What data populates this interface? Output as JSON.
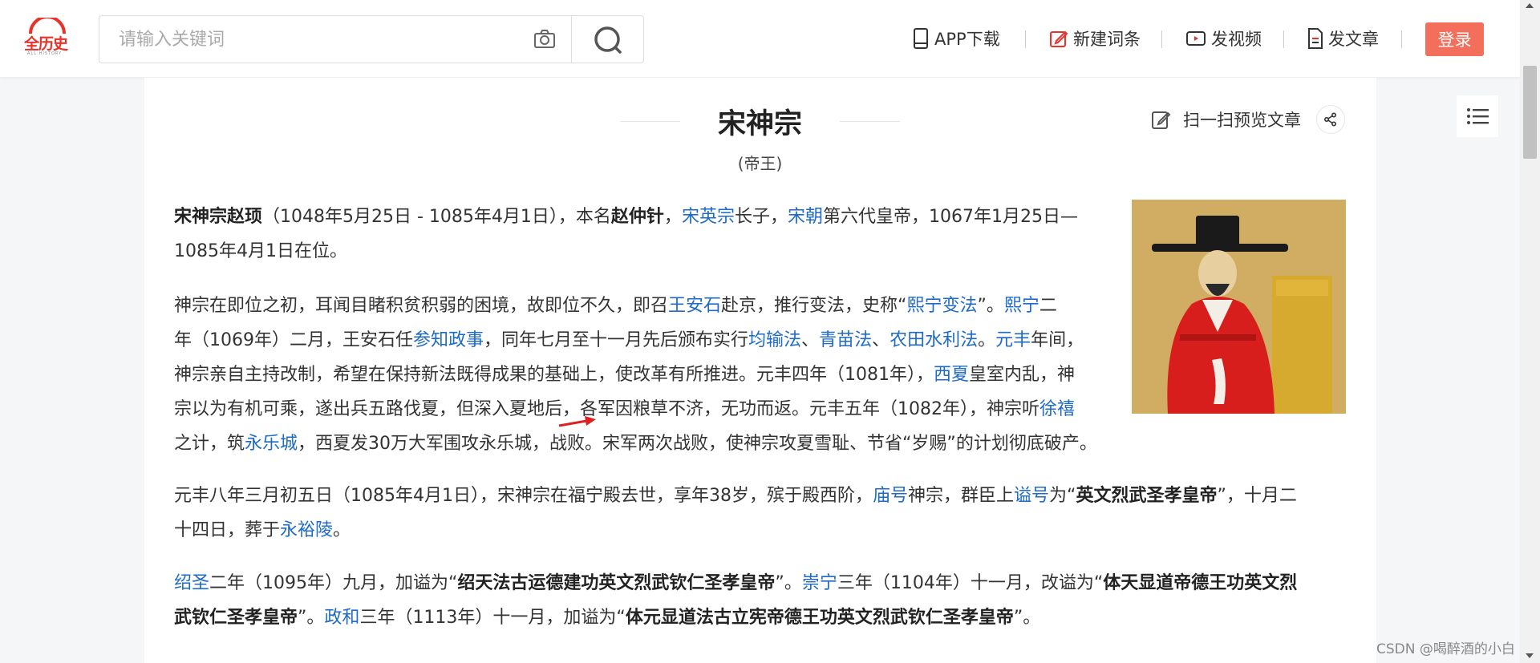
{
  "header": {
    "logo_text": "全历史",
    "logo_sub": "ALL HISTORY",
    "search_placeholder": "请输入关键词",
    "nav": [
      {
        "label": "APP下载",
        "icon": "phone-icon"
      },
      {
        "label": "新建词条",
        "icon": "edit-icon"
      },
      {
        "label": "发视频",
        "icon": "video-icon"
      },
      {
        "label": "发文章",
        "icon": "document-icon"
      }
    ],
    "login_label": "登录"
  },
  "article": {
    "title": "宋神宗",
    "subtitle": "(帝王)",
    "scan_label": "扫一扫预览文章",
    "paragraphs": [
      [
        {
          "t": "宋神宗赵顼",
          "b": true
        },
        {
          "t": "（1048年5月25日 - 1085年4月1日），本名"
        },
        {
          "t": "赵仲针",
          "b": true
        },
        {
          "t": "，"
        },
        {
          "t": "宋英宗",
          "link": true
        },
        {
          "t": "长子，"
        },
        {
          "t": "宋朝",
          "link": true
        },
        {
          "t": "第六代皇帝，1067年1月25日—"
        },
        {
          "br": true
        },
        {
          "t": "1085年4月1日在位。"
        }
      ],
      [
        {
          "t": "神宗在即位之初，耳闻目睹积贫积弱的困境，故即位不久，即召"
        },
        {
          "t": "王安石",
          "link": true
        },
        {
          "t": "赴京，推行变法，史称“"
        },
        {
          "t": "熙宁变法",
          "link": true
        },
        {
          "t": "”。"
        },
        {
          "t": "熙宁",
          "link": true
        },
        {
          "t": "二"
        },
        {
          "br": true
        },
        {
          "t": "年（1069年）二月，王安石任"
        },
        {
          "t": "参知政事",
          "link": true
        },
        {
          "t": "，同年七月至十一月先后颁布实行"
        },
        {
          "t": "均输法",
          "link": true
        },
        {
          "t": "、"
        },
        {
          "t": "青苗法",
          "link": true
        },
        {
          "t": "、"
        },
        {
          "t": "农田水利法",
          "link": true
        },
        {
          "t": "。"
        },
        {
          "t": "元丰",
          "link": true
        },
        {
          "t": "年间，"
        },
        {
          "br": true
        },
        {
          "t": "神宗亲自主持改制，希望在保持新法既得成果的基础上，使改革有所推进。元丰四年（1081年），"
        },
        {
          "t": "西夏",
          "link": true
        },
        {
          "t": "皇室内乱，神"
        },
        {
          "br": true
        },
        {
          "t": "宗以为有机可乘，遂出兵五路伐夏，但深入夏地后，各军因粮草不济，无功而返。元丰五年（1082年），神宗听"
        },
        {
          "t": "徐禧",
          "link": true
        },
        {
          "br": true
        },
        {
          "t": "之计，筑"
        },
        {
          "t": "永乐城",
          "link": true
        },
        {
          "t": "，西夏发30万大军围攻永乐城，战败。宋军两次战败，使神宗攻夏雪耻、节省“岁赐”的计划彻底破产。"
        }
      ],
      [
        {
          "t": "元丰八年三月初五日（1085年4月1日），宋神宗在福宁殿去世，享年38岁，殡于殿西阶，"
        },
        {
          "t": "庙号",
          "link": true
        },
        {
          "t": "神宗，群臣上"
        },
        {
          "t": "谥号",
          "link": true
        },
        {
          "t": "为“"
        },
        {
          "t": "英文烈武圣孝皇帝",
          "b": true
        },
        {
          "t": "”，十月二"
        },
        {
          "br": true
        },
        {
          "t": "十四日，葬于"
        },
        {
          "t": "永裕陵",
          "link": true
        },
        {
          "t": "。"
        }
      ],
      [
        {
          "t": "绍圣",
          "link": true
        },
        {
          "t": "二年（1095年）九月，加谥为“"
        },
        {
          "t": "绍天法古运德建功英文烈武钦仁圣孝皇帝",
          "b": true
        },
        {
          "t": "”。"
        },
        {
          "t": "崇宁",
          "link": true
        },
        {
          "t": "三年（1104年）十一月，改谥为“"
        },
        {
          "t": "体天显道帝德王功英文烈",
          "b": true
        },
        {
          "br": true
        },
        {
          "t": "武钦仁圣孝皇帝",
          "b": true
        },
        {
          "t": "”。"
        },
        {
          "t": "政和",
          "link": true
        },
        {
          "t": "三年（1113年）十一月，加谥为“"
        },
        {
          "t": "体元显道法古立宪帝德王功英文烈武钦仁圣孝皇帝",
          "b": true
        },
        {
          "t": "”。"
        }
      ]
    ]
  },
  "watermark": "CSDN @喝醉酒的小白",
  "colors": {
    "brand": "#e8322a",
    "login_bg": "#f36e5b",
    "link": "#1e6ac8"
  }
}
